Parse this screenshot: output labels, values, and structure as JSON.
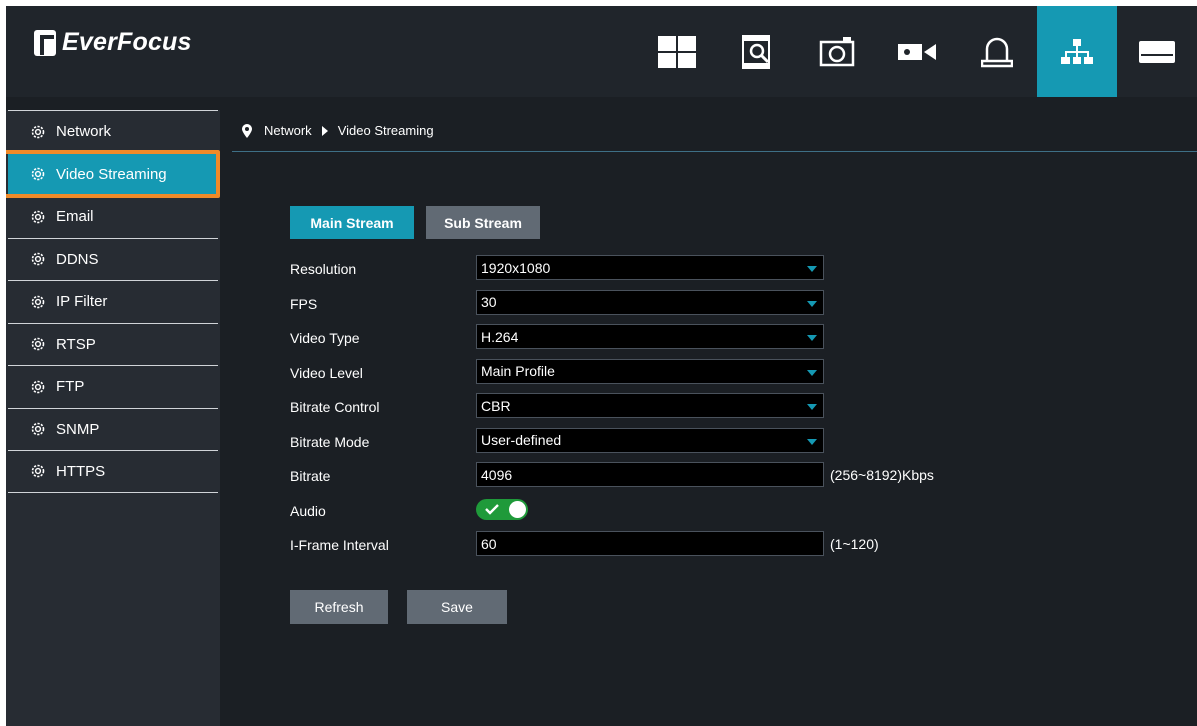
{
  "brand": {
    "name": "EverFocus"
  },
  "topnav": {
    "items": [
      {
        "icon": "live-view-grid-icon"
      },
      {
        "icon": "playback-search-icon"
      },
      {
        "icon": "snapshot-camera-icon"
      },
      {
        "icon": "camera-record-icon"
      },
      {
        "icon": "alarm-bell-icon"
      },
      {
        "icon": "network-icon",
        "active": true
      },
      {
        "icon": "storage-device-icon"
      }
    ]
  },
  "sidebar": {
    "items": [
      {
        "label": "Network"
      },
      {
        "label": "Video Streaming",
        "active": true
      },
      {
        "label": "Email"
      },
      {
        "label": "DDNS"
      },
      {
        "label": "IP Filter"
      },
      {
        "label": "RTSP"
      },
      {
        "label": "FTP"
      },
      {
        "label": "SNMP"
      },
      {
        "label": "HTTPS"
      }
    ]
  },
  "breadcrumb": {
    "level1": "Network",
    "level2": "Video Streaming"
  },
  "tabs": {
    "main": "Main Stream",
    "sub": "Sub Stream"
  },
  "form": {
    "resolution": {
      "label": "Resolution",
      "value": "1920x1080"
    },
    "fps": {
      "label": "FPS",
      "value": "30"
    },
    "video_type": {
      "label": "Video Type",
      "value": "H.264"
    },
    "video_level": {
      "label": "Video Level",
      "value": "Main Profile"
    },
    "bitrate_control": {
      "label": "Bitrate Control",
      "value": "CBR"
    },
    "bitrate_mode": {
      "label": "Bitrate Mode",
      "value": "User-defined"
    },
    "bitrate": {
      "label": "Bitrate",
      "value": "4096",
      "hint": "(256~8192)Kbps"
    },
    "audio": {
      "label": "Audio",
      "enabled": true
    },
    "iframe": {
      "label": "I-Frame Interval",
      "value": "60",
      "hint": "(1~120)"
    }
  },
  "actions": {
    "refresh": "Refresh",
    "save": "Save"
  },
  "colors": {
    "accent": "#1599b3",
    "highlight": "#f08a28",
    "toggle_on": "#1f9a3a"
  }
}
